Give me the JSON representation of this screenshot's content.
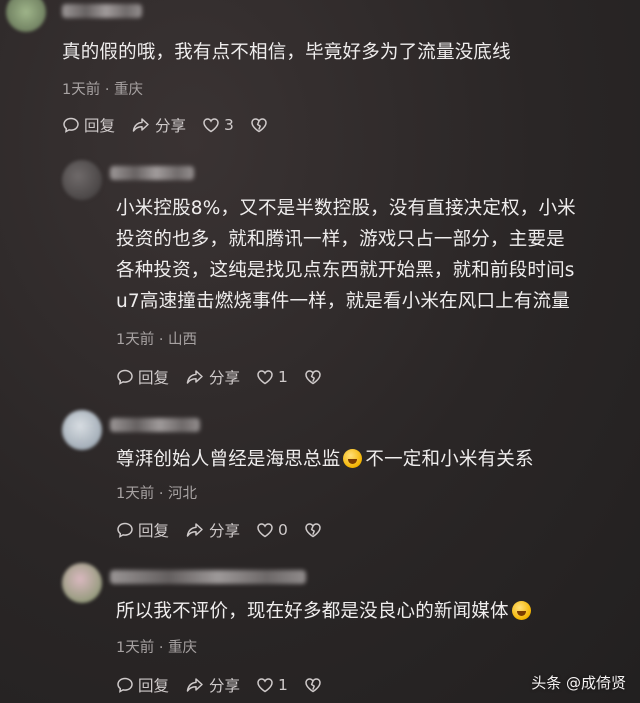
{
  "comments": [
    {
      "text": "真的假的哦，我有点不相信，毕竟好多为了流量没底线",
      "meta": "1天前 · 重庆",
      "reply": "回复",
      "share": "分享",
      "likes": "3"
    },
    {
      "text_lines": [
        "小米控股8%，又不是半数控股，没有直接决定权，小米",
        "投资的也多，就和腾讯一样，游戏只占一部分，主要是",
        "各种投资，这纯是找见点东西就开始黑，就和前段时间s",
        "u7高速撞击燃烧事件一样，就是看小米在风口上有流量"
      ],
      "meta": "1天前 · 山西",
      "reply": "回复",
      "share": "分享",
      "likes": "1"
    },
    {
      "text_before": "尊湃创始人曾经是海思总监",
      "text_after": "不一定和小米有关系",
      "meta": "1天前 · 河北",
      "reply": "回复",
      "share": "分享",
      "likes": "0"
    },
    {
      "text_before": "所以我不评价，现在好多都是没良心的新闻媒体",
      "meta": "1天前 · 重庆",
      "reply": "回复",
      "share": "分享",
      "likes": "1"
    }
  ],
  "watermark": "头条 @成倚贤",
  "icons": {
    "reply": "comment-bubble-icon",
    "share": "share-arrow-icon",
    "like": "heart-icon",
    "dislike": "broken-heart-icon",
    "emoji": "laughing-tears-emoji-icon"
  }
}
